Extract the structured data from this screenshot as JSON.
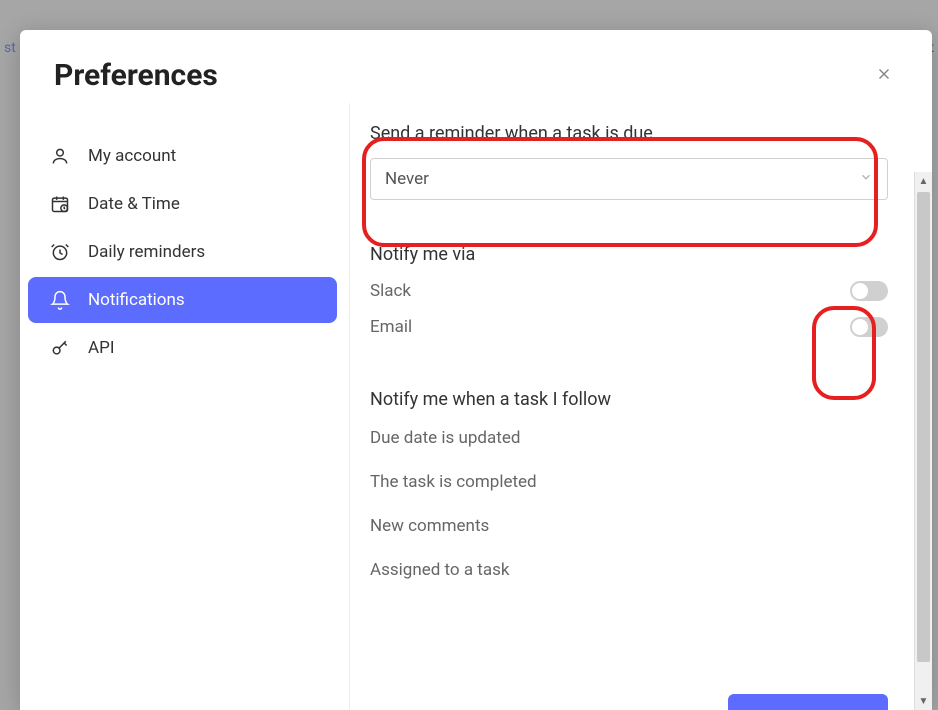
{
  "modal": {
    "title": "Preferences"
  },
  "sidebar": {
    "items": [
      {
        "label": "My account",
        "icon": "user-icon"
      },
      {
        "label": "Date & Time",
        "icon": "calendar-icon"
      },
      {
        "label": "Daily reminders",
        "icon": "alarm-icon"
      },
      {
        "label": "Notifications",
        "icon": "bell-icon"
      },
      {
        "label": "API",
        "icon": "key-icon"
      }
    ],
    "active_index": 3
  },
  "content": {
    "reminder": {
      "label": "Send a reminder when a task is due",
      "value": "Never"
    },
    "notify_via": {
      "title": "Notify me via",
      "channels": [
        {
          "label": "Slack",
          "on": false
        },
        {
          "label": "Email",
          "on": false
        }
      ]
    },
    "follow": {
      "title": "Notify me when a task I follow",
      "items": [
        "Due date is updated",
        "The task is completed",
        "New comments",
        "Assigned to a task"
      ]
    }
  },
  "colors": {
    "accent": "#5b6cff",
    "annotation": "#e62020"
  }
}
